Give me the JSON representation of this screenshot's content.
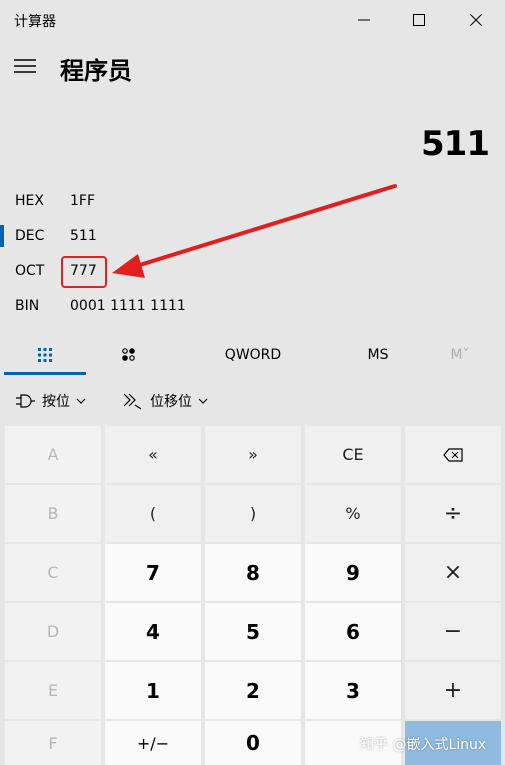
{
  "window": {
    "title": "计算器"
  },
  "header": {
    "mode": "程序员"
  },
  "display": {
    "value": "511"
  },
  "radix": [
    {
      "label": "HEX",
      "value": "1FF",
      "active": false
    },
    {
      "label": "DEC",
      "value": "511",
      "active": true
    },
    {
      "label": "OCT",
      "value": "777",
      "active": false
    },
    {
      "label": "BIN",
      "value": "0001 1111 1111",
      "active": false
    }
  ],
  "tabs": {
    "keypad_icon": "keypad-icon",
    "bitpad_icon": "bit-toggle-icon",
    "word_size": "QWORD",
    "ms": "MS",
    "mv": "M˅"
  },
  "opbar": {
    "bitwise": "按位",
    "bitshift": "位移位"
  },
  "keys": {
    "r1": [
      "A",
      "«",
      "»",
      "CE",
      "⌫"
    ],
    "r2": [
      "B",
      "(",
      ")",
      "%",
      "÷"
    ],
    "r3": [
      "C",
      "7",
      "8",
      "9",
      "×"
    ],
    "r4": [
      "D",
      "4",
      "5",
      "6",
      "−"
    ],
    "r5": [
      "E",
      "1",
      "2",
      "3",
      "+"
    ],
    "r6": [
      "F",
      "+/−",
      "0",
      "",
      ""
    ]
  },
  "watermark": "知乎 @嵌入式Linux",
  "colors": {
    "accent": "#0063b1",
    "annotation": "#e02020"
  }
}
